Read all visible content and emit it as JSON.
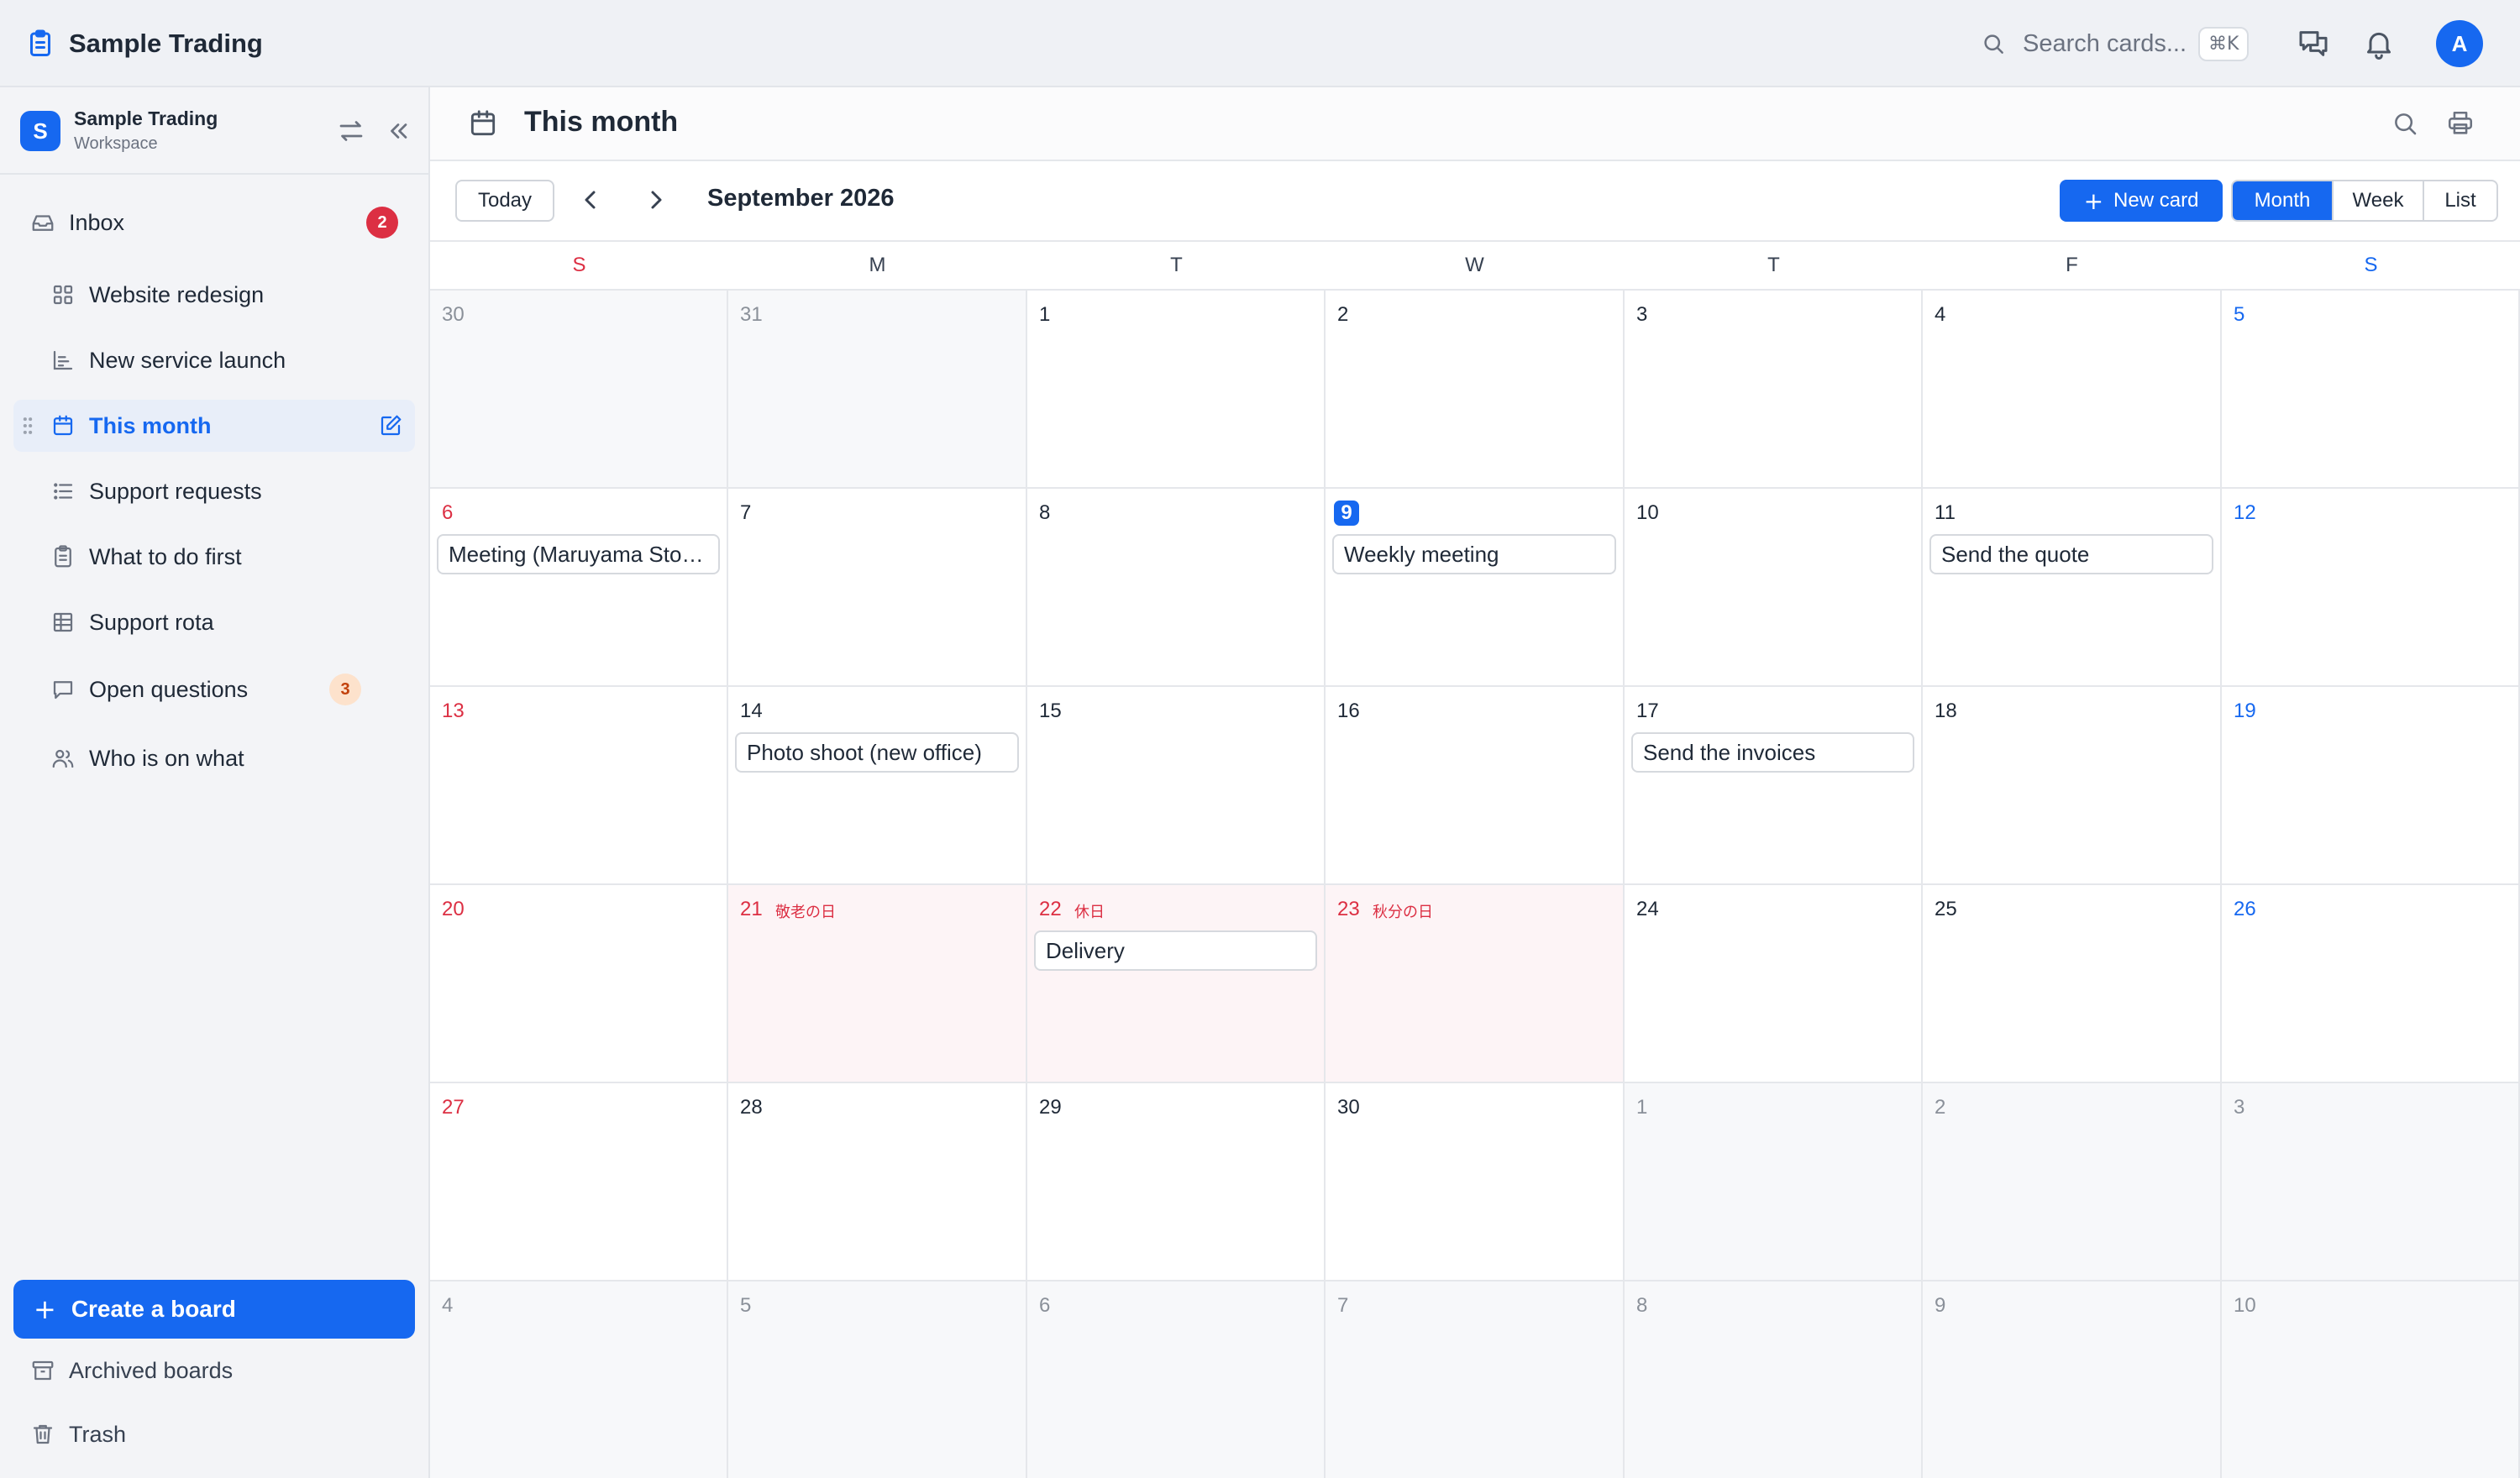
{
  "app": {
    "title": "Sample Trading"
  },
  "topbar": {
    "search_placeholder": "Search cards...",
    "search_shortcut": "⌘K",
    "avatar_initial": "A"
  },
  "workspace": {
    "badge": "S",
    "name": "Sample Trading",
    "type": "Workspace"
  },
  "sidebar": {
    "inbox": {
      "label": "Inbox",
      "count": "2"
    },
    "boards": [
      {
        "label": "Website redesign",
        "icon": "grid-icon"
      },
      {
        "label": "New service launch",
        "icon": "chart-icon"
      },
      {
        "label": "This month",
        "icon": "calendar-icon",
        "active": true
      },
      {
        "label": "Support requests",
        "icon": "list-icon"
      },
      {
        "label": "What to do first",
        "icon": "clipboard-icon"
      },
      {
        "label": "Support rota",
        "icon": "table-icon"
      },
      {
        "label": "Open questions",
        "icon": "chat-icon",
        "count": "3"
      },
      {
        "label": "Who is on what",
        "icon": "users-icon"
      }
    ],
    "create_board": "Create a board",
    "archived": "Archived boards",
    "trash": "Trash"
  },
  "page": {
    "title": "This month"
  },
  "toolbar": {
    "today": "Today",
    "month_label": "September 2026",
    "new_card": "New card",
    "views": [
      "Month",
      "Week",
      "List"
    ],
    "active_view": "Month"
  },
  "weekdays": [
    "S",
    "M",
    "T",
    "W",
    "T",
    "F",
    "S"
  ],
  "calendar": {
    "weeks": [
      [
        {
          "d": "30",
          "other": true
        },
        {
          "d": "31",
          "other": true
        },
        {
          "d": "1"
        },
        {
          "d": "2"
        },
        {
          "d": "3"
        },
        {
          "d": "4"
        },
        {
          "d": "5"
        }
      ],
      [
        {
          "d": "6",
          "event": "Meeting (Maruyama Stores)"
        },
        {
          "d": "7"
        },
        {
          "d": "8"
        },
        {
          "d": "9",
          "today": true,
          "event": "Weekly meeting"
        },
        {
          "d": "10"
        },
        {
          "d": "11",
          "event": "Send the quote"
        },
        {
          "d": "12"
        }
      ],
      [
        {
          "d": "13"
        },
        {
          "d": "14",
          "event": "Photo shoot (new office)"
        },
        {
          "d": "15"
        },
        {
          "d": "16"
        },
        {
          "d": "17",
          "event": "Send the invoices"
        },
        {
          "d": "18"
        },
        {
          "d": "19"
        }
      ],
      [
        {
          "d": "20"
        },
        {
          "d": "21",
          "holiday": "敬老の日"
        },
        {
          "d": "22",
          "holiday": "休日",
          "event": "Delivery"
        },
        {
          "d": "23",
          "holiday": "秋分の日"
        },
        {
          "d": "24"
        },
        {
          "d": "25"
        },
        {
          "d": "26"
        }
      ],
      [
        {
          "d": "27"
        },
        {
          "d": "28"
        },
        {
          "d": "29"
        },
        {
          "d": "30"
        },
        {
          "d": "1",
          "other": true
        },
        {
          "d": "2",
          "other": true
        },
        {
          "d": "3",
          "other": true
        }
      ],
      [
        {
          "d": "4",
          "other": true
        },
        {
          "d": "5",
          "other": true
        },
        {
          "d": "6",
          "other": true
        },
        {
          "d": "7",
          "other": true
        },
        {
          "d": "8",
          "other": true
        },
        {
          "d": "9",
          "other": true
        },
        {
          "d": "10",
          "other": true
        }
      ]
    ]
  },
  "colors": {
    "accent": "#1668f0",
    "sunday": "#dc2f43",
    "saturday": "#1668f0",
    "holiday_bg": "#fdf4f6"
  }
}
